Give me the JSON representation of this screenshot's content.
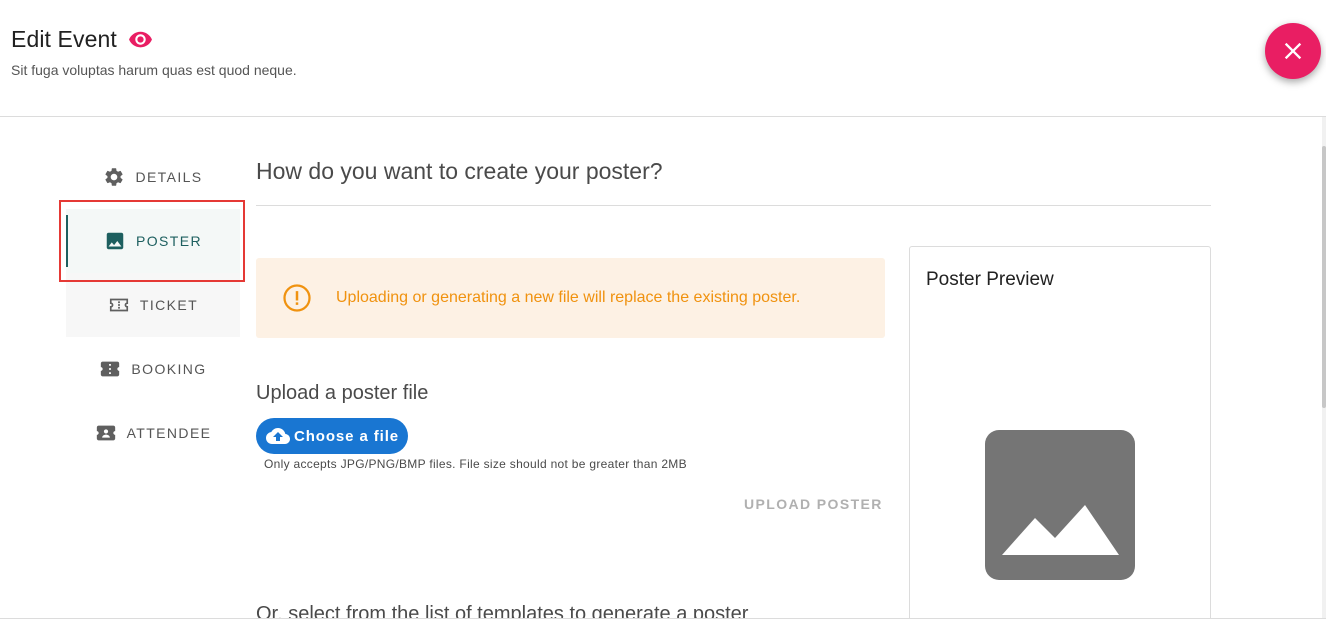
{
  "header": {
    "title": "Edit Event",
    "subtitle": "Sit fuga voluptas harum quas est quod neque.",
    "icons": {
      "view": "eye-icon",
      "close": "close-icon"
    }
  },
  "sidebar": {
    "items": [
      {
        "label": "DETAILS",
        "icon": "gear-icon",
        "state": "default"
      },
      {
        "label": "POSTER",
        "icon": "image-icon",
        "state": "active"
      },
      {
        "label": "TICKET",
        "icon": "ticket-icon",
        "state": "hovered"
      },
      {
        "label": "BOOKING",
        "icon": "booking-icon",
        "state": "default"
      },
      {
        "label": "ATTENDEE",
        "icon": "attendee-icon",
        "state": "default"
      }
    ]
  },
  "main": {
    "heading": "How do you want to create your poster?",
    "warning": {
      "text": "Uploading or generating a new file will replace the existing poster.",
      "icon": "warning-icon"
    },
    "upload": {
      "heading": "Upload a poster file",
      "choose_label": "Choose a file",
      "hint": "Only accepts JPG/PNG/BMP files. File size should not be greater than 2MB",
      "upload_label": "UPLOAD POSTER",
      "icon": "cloud-upload-icon"
    },
    "templates_heading": "Or, select from the list of templates to generate a poster"
  },
  "preview": {
    "title": "Poster Preview",
    "icon": "image-placeholder-icon"
  },
  "colors": {
    "accent": "#e91e63",
    "primary": "#1976d2",
    "active_nav": "#1d5f5f",
    "warning_bg": "#fdf1e4",
    "warning_text": "#f0920f"
  }
}
